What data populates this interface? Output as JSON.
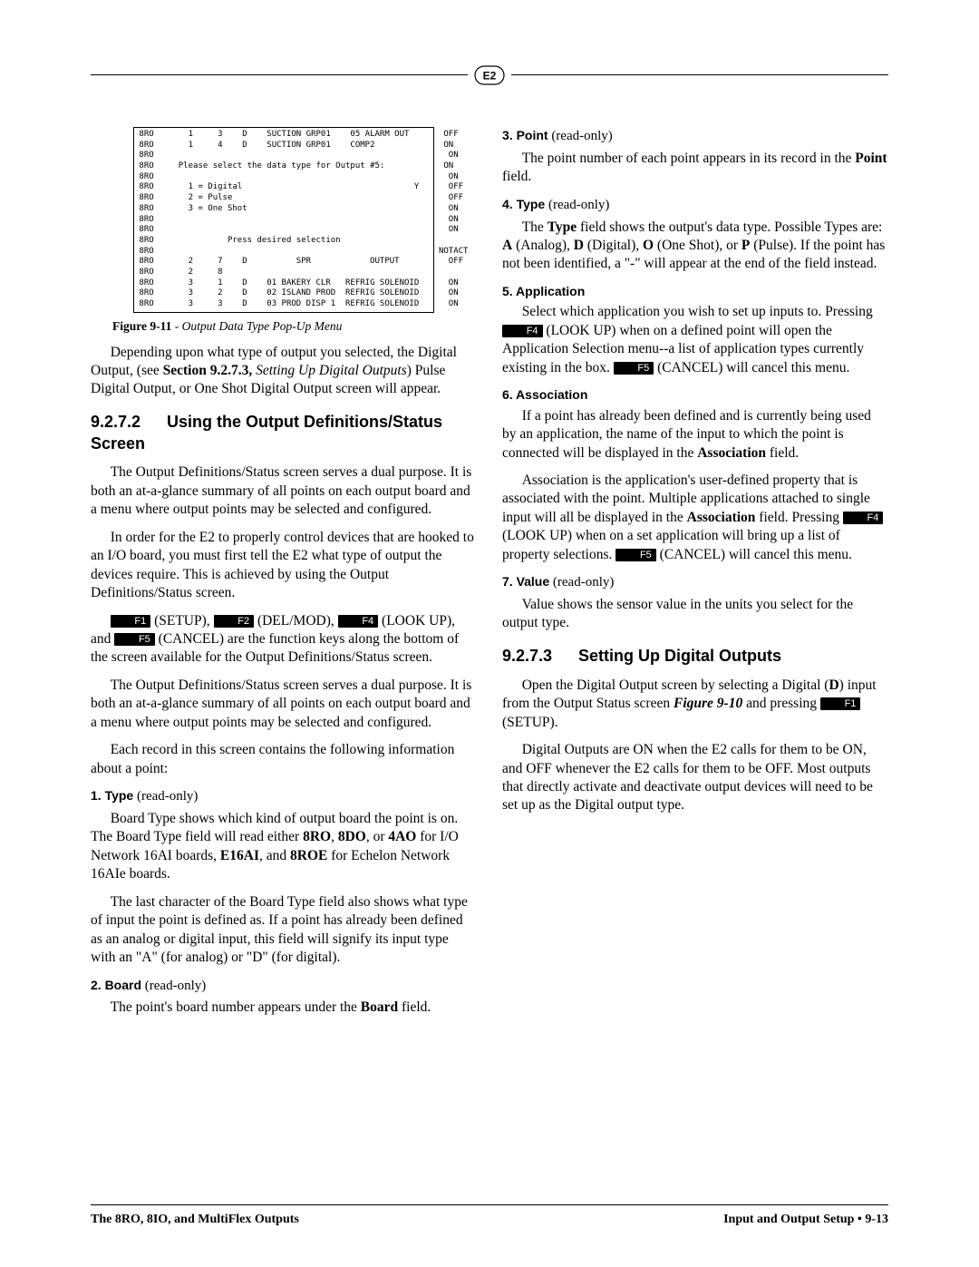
{
  "logo_text": "E2",
  "figure_text": " 8RO       1     3    D    SUCTION GRP01    05 ALARM OUT       OFF\n 8RO       1     4    D    SUCTION GRP01    COMP2              ON\n 8RO                                                            ON\n 8RO     Please select the data type for Output #5:            ON\n 8RO                                                            ON\n 8RO       1 = Digital                                   Y      OFF\n 8RO       2 = Pulse                                            OFF\n 8RO       3 = One Shot                                         ON\n 8RO                                                            ON\n 8RO                                                            ON\n 8RO               Press desired selection\n 8RO                                                          NOTACT\n 8RO       2     7    D          SPR            OUTPUT          OFF\n 8RO       2     8\n 8RO       3     1    D    01 BAKERY CLR   REFRIG SOLENOID      ON\n 8RO       3     2    D    02 ISLAND PROD  REFRIG SOLENOID      ON\n 8RO       3     3    D    03 PROD DISP 1  REFRIG SOLENOID      ON",
  "fig_caption_label": "Figure 9-11",
  "fig_caption_text": " - Output Data Type Pop-Up Menu",
  "left": {
    "p1_a": "Depending upon what type of output you selected, the Digital Output, (see ",
    "p1_b": "Section 9.2.7.3,",
    "p1_c": " Setting Up Digital Outputs",
    "p1_d": ") Pulse Digital Output, or One Shot Digital Output screen will appear.",
    "sec_num": "9.2.7.2",
    "sec_title": "Using the Output Definitions/Status Screen",
    "p2": "The Output Definitions/Status screen serves a dual purpose. It is both an at-a-glance summary of all points on each output board and a menu where output points may be selected and configured.",
    "p3": "In order for the E2 to properly control devices that are hooked to an I/O board, you must first tell the E2 what type of output the devices require. This is achieved by using the Output Definitions/Status screen.",
    "fk": {
      "f1": "F1",
      "f2": "F2",
      "f4": "F4",
      "f5": "F5"
    },
    "p4_a": " (SETUP), ",
    "p4_b": " (DEL/MOD), ",
    "p4_c": " (LOOK UP), and ",
    "p4_d": " (CANCEL) are the function keys along the bottom of the screen available for the Output Definitions/Status screen.",
    "p5": "The Output Definitions/Status screen serves a dual purpose. It is both an at-a-glance summary of all points on each output board and a menu where output points may be selected and configured.",
    "p6": "Each record in this screen contains the following information about a point:",
    "i1_t": "1. Type",
    "i1_ro": " (read-only)",
    "i1_p_a": "Board Type shows which kind of output board the point is on. The Board Type field will read either ",
    "i1_p_b": "8RO",
    "i1_p_c": ", ",
    "i1_p_d": "8DO",
    "i1_p_e": ", or ",
    "i1_p_f": "4AO",
    "i1_p_g": " for I/O Network 16AI boards, ",
    "i1_p_h": "E16AI",
    "i1_p_i": ", and ",
    "i1_p_j": "8ROE",
    "i1_p_k": " for Echelon Network 16AIe boards.",
    "i1_p2": "The last character of the Board Type field also shows what type of input the point is defined as. If a point has already been defined as an analog or digital input, this field will signify its input type with an \"A\" (for analog) or \"D\" (for digital).",
    "i2_t": "2. Board",
    "i2_ro": " (read-only)",
    "i2_p_a": "The point's board number appears under the ",
    "i2_p_b": "Board",
    "i2_p_c": " field."
  },
  "right": {
    "i3_t": "3. Point",
    "i3_ro": " (read-only)",
    "i3_p_a": "The point number of each point appears in its record in the ",
    "i3_p_b": "Point",
    "i3_p_c": " field.",
    "i4_t": "4. Type",
    "i4_ro": " (read-only)",
    "i4_p_a": "The ",
    "i4_p_b": "Type",
    "i4_p_c": " field shows the output's data type. Possible Types are: ",
    "i4_p_d": "A",
    "i4_p_e": " (Analog), ",
    "i4_p_f": "D",
    "i4_p_g": " (Digital), ",
    "i4_p_h": "O",
    "i4_p_i": " (One Shot), or ",
    "i4_p_j": "P",
    "i4_p_k": " (Pulse). If the point has not been identified, a \"-\" will appear at the end of the field instead.",
    "i5_t": "5. Application",
    "i5_p_a": "Select which application you wish to set up inputs to. Pressing ",
    "i5_p_b": " (LOOK UP) when on a defined point will open the Application Selection menu--a list of application types currently existing in the box. ",
    "i5_p_c": " (CANCEL) will cancel this menu.",
    "i6_t": "6. Association",
    "i6_p1_a": "If a point has already been defined and is currently being used by an application, the name of the input to which the point is connected will be displayed in the ",
    "i6_p1_b": "Association",
    "i6_p1_c": " field.",
    "i6_p2_a": "Association is the application's user-defined property that is associated with the point. Multiple applications attached to single input will all be displayed in the ",
    "i6_p2_b": "Association",
    "i6_p2_c": " field. Pressing ",
    "i6_p2_d": " (LOOK UP) when on a set application will bring up a list of property selections. ",
    "i6_p2_e": " (CANCEL) will cancel this menu.",
    "i7_t": "7. Value",
    "i7_ro": " (read-only)",
    "i7_p": "Value shows the sensor value in the units you select for the output type.",
    "sec_num": "9.2.7.3",
    "sec_title": "Setting Up Digital Outputs",
    "p1_a": "Open the Digital Output screen by selecting a Digital (",
    "p1_b": "D",
    "p1_c": ") input from the Output Status screen ",
    "p1_d": "Figure 9-10",
    "p1_e": " and pressing ",
    "p1_f": " (SETUP).",
    "p2": "Digital Outputs are ON when the E2 calls for them to be ON, and OFF whenever the E2 calls for them to be OFF. Most outputs that directly activate and deactivate output devices will need to be set up as the Digital output type."
  },
  "footer_left": "The 8RO, 8IO, and MultiFlex Outputs",
  "footer_right_a": "Input and Output Setup • ",
  "footer_right_b": "9-13"
}
